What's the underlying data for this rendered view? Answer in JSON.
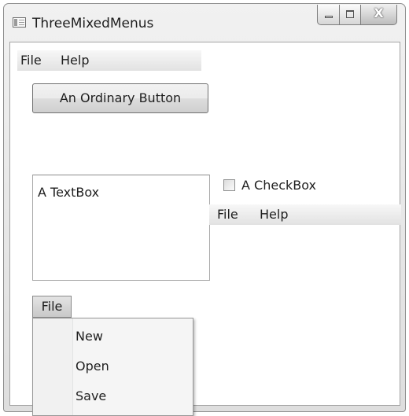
{
  "window": {
    "title": "ThreeMixedMenus",
    "close_glyph": "X"
  },
  "top_menu": {
    "items": [
      "File",
      "Help"
    ]
  },
  "ordinary_button": {
    "label": "An Ordinary Button"
  },
  "textbox": {
    "value": "A TextBox"
  },
  "checkbox": {
    "label": "A CheckBox",
    "checked": false
  },
  "right_menu": {
    "items": [
      "File",
      "Help"
    ]
  },
  "bottom_menu": {
    "label": "File",
    "dropdown_items": [
      "New",
      "Open",
      "Save"
    ]
  }
}
